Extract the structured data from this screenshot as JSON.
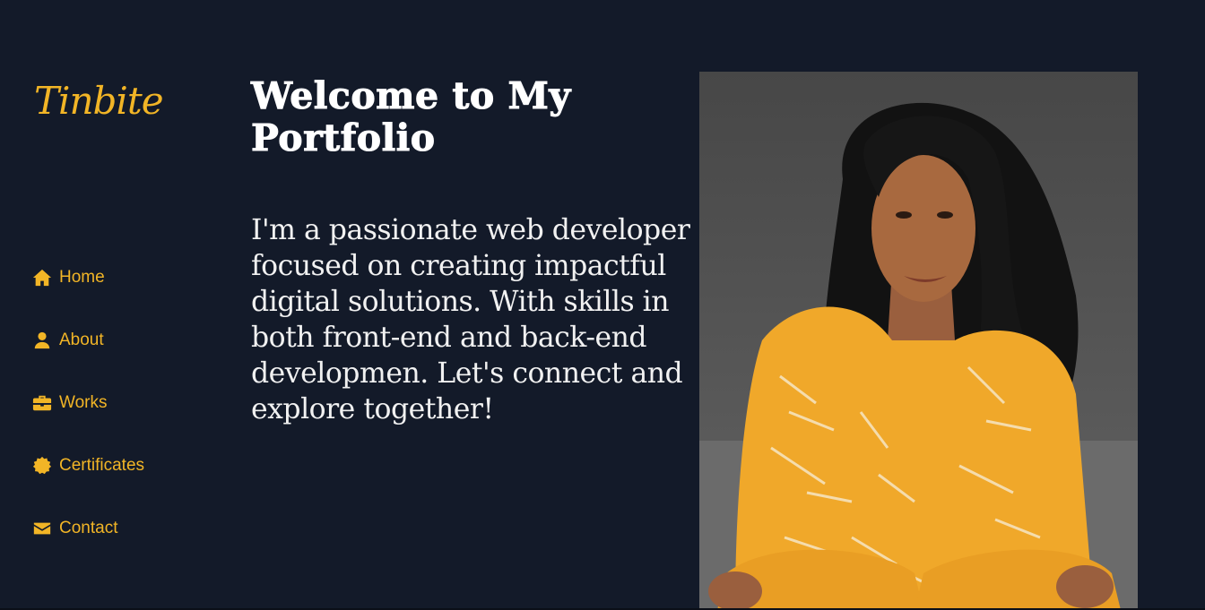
{
  "brand": {
    "logo_text": "Tinbite",
    "accent_color": "#f2b526",
    "background": "#131a29"
  },
  "sidebar": {
    "items": [
      {
        "label": "Home",
        "icon": "home-icon"
      },
      {
        "label": "About",
        "icon": "user-icon"
      },
      {
        "label": "Works",
        "icon": "briefcase-icon"
      },
      {
        "label": "Certificates",
        "icon": "certificate-icon"
      },
      {
        "label": "Contact",
        "icon": "envelope-icon"
      }
    ]
  },
  "main": {
    "title": "Welcome to My Portfolio",
    "intro": "I'm a passionate web developer focused on creating impactful digital solutions. With skills in both front-end and back-end developmen. Let's connect and explore together!"
  },
  "portrait": {
    "description_icon": "portrait-photo"
  }
}
